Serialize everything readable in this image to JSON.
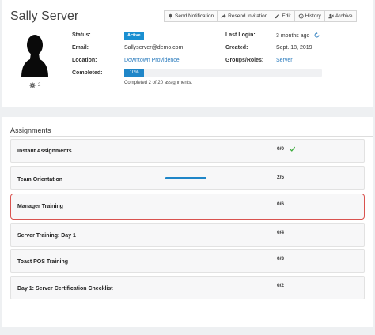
{
  "profile": {
    "name": "Sally Server",
    "toolbar": [
      {
        "label": "Send Notification",
        "icon": "bell-icon"
      },
      {
        "label": "Resend Invitation",
        "icon": "share-icon"
      },
      {
        "label": "Edit",
        "icon": "pencil-icon"
      },
      {
        "label": "History",
        "icon": "history-icon"
      },
      {
        "label": "Archive",
        "icon": "archive-user-icon"
      }
    ],
    "gear_count": "2",
    "fields": {
      "status_label": "Status:",
      "status_value": "Active",
      "email_label": "Email:",
      "email_value": "Sallyserver@demo.com",
      "location_label": "Location:",
      "location_value": "Downtown Providence",
      "completed_label": "Completed:",
      "completed_value": "10%",
      "completed_fraction": 0.1,
      "completed_note": "Completed 2 of 20 assignments.",
      "last_login_label": "Last Login:",
      "last_login_value": "3 months ago",
      "created_label": "Created:",
      "created_value": "Sept. 18, 2019",
      "groups_label": "Groups/Roles:",
      "groups_value": "Server"
    },
    "colors": {
      "accent": "#1f86c8",
      "link": "#2a7bbd",
      "selected_border": "#d9534f",
      "check": "#3cab3c"
    }
  },
  "assignments": {
    "title": "Assignments",
    "rows": [
      {
        "label": "Instant Assignments",
        "count": "0/0"
      },
      {
        "label": "Team Orientation",
        "count": "2/5"
      },
      {
        "label": "Manager Training",
        "count": "0/6"
      },
      {
        "label": "Server Training: Day 1",
        "count": "0/4"
      },
      {
        "label": "Toast POS Training",
        "count": "0/3"
      },
      {
        "label": "Day 1: Server Certification Checklist",
        "count": "0/2"
      }
    ]
  }
}
